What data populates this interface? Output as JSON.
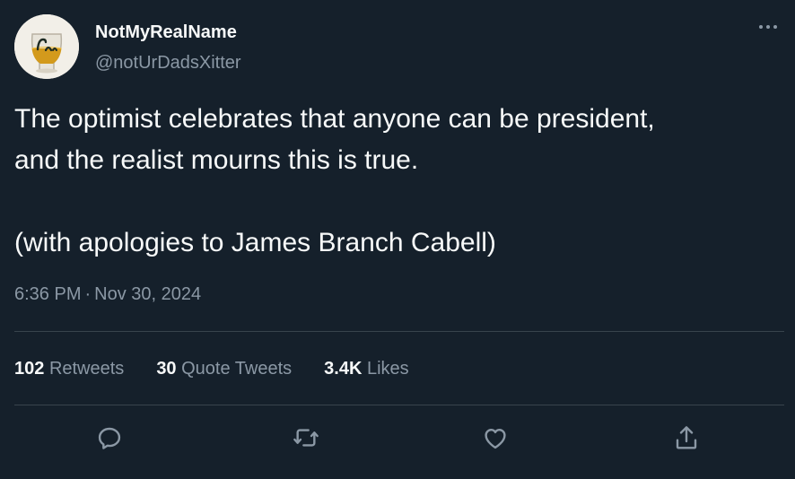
{
  "author": {
    "display_name": "NotMyRealName",
    "handle": "@notUrDadsXitter"
  },
  "tweet": {
    "text": "The optimist celebrates that anyone can be president,\nand the realist mourns this is true.\n\n(with apologies to James Branch Cabell)",
    "time": "6:36 PM",
    "separator": "·",
    "date": "Nov 30, 2024"
  },
  "stats": [
    {
      "count": "102",
      "label": "Retweets"
    },
    {
      "count": "30",
      "label": "Quote Tweets"
    },
    {
      "count": "3.4K",
      "label": "Likes"
    }
  ],
  "actions": [
    "reply-icon",
    "retweet-icon",
    "like-icon",
    "share-icon"
  ],
  "colors": {
    "background": "#15202b",
    "primary_text": "#f7f9f9",
    "secondary_text": "#8b98a5",
    "divider": "#38444d"
  }
}
